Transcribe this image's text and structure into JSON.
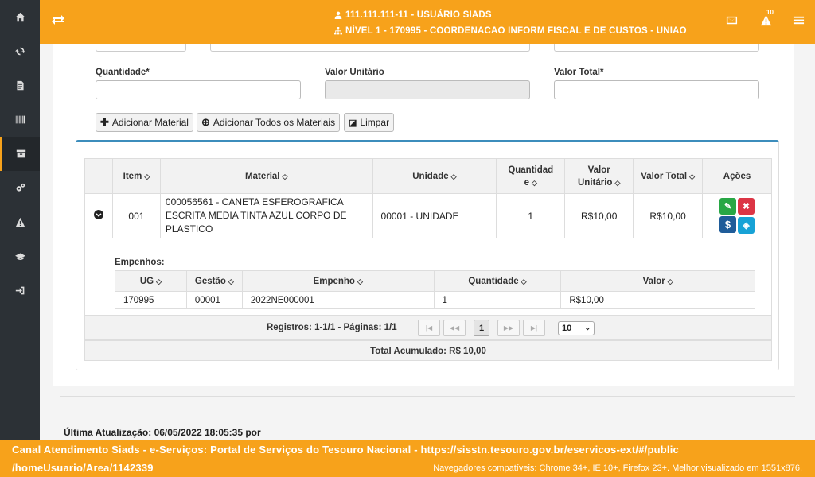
{
  "header": {
    "user": "111.111.111-11 - USUÁRIO SIADS",
    "level": "NÍVEL 1 - 170995 - COORDENACAO INFORM FISCAL E DE CUSTOS - UNIAO",
    "alert_count": "10"
  },
  "sidebar": {
    "items": [
      {
        "icon": "home-icon"
      },
      {
        "icon": "refresh-icon"
      },
      {
        "icon": "document-icon"
      },
      {
        "icon": "barcode-icon"
      },
      {
        "icon": "archive-icon",
        "active": true
      },
      {
        "icon": "gears-icon"
      },
      {
        "icon": "warning-icon"
      },
      {
        "icon": "graduation-cap-icon"
      },
      {
        "icon": "sign-in-icon"
      }
    ]
  },
  "form": {
    "quantidade_label": "Quantidade*",
    "quantidade_value": "",
    "valor_unitario_label": "Valor Unitário",
    "valor_unitario_value": "",
    "valor_total_label": "Valor Total*",
    "valor_total_value": ""
  },
  "buttons": {
    "adicionar": "Adicionar Material",
    "adicionar_todos": "Adicionar Todos os Materiais",
    "limpar": "Limpar"
  },
  "table": {
    "headers": [
      "Item",
      "Material",
      "Unidade",
      "Quantidade",
      "Valor Unitário",
      "Valor Total",
      "Ações"
    ],
    "header_quantidade_l1": "Quantidad",
    "header_quantidade_l2": "e",
    "header_valor_unitario_l1": "Valor",
    "header_valor_unitario_l2": "Unitário",
    "rows": [
      {
        "item": "001",
        "material": "000056561 - CANETA ESFEROGRAFICA ESCRITA MEDIA TINTA AZUL CORPO DE PLASTICO",
        "unidade": "00001 - UNIDADE",
        "quantidade": "1",
        "valor_unitario": "R$10,00",
        "valor_total": "R$10,00"
      }
    ]
  },
  "empenhos": {
    "label": "Empenhos:",
    "headers": [
      "UG",
      "Gestão",
      "Empenho",
      "Quantidade",
      "Valor"
    ],
    "rows": [
      {
        "ug": "170995",
        "gestao": "00001",
        "empenho": "2022NE000001",
        "quantidade": "1",
        "valor": "R$10,00"
      }
    ]
  },
  "pager": {
    "info": "Registros: 1-1/1 - Páginas: 1/1",
    "current_page": "1",
    "page_size": "10"
  },
  "total": "Total Acumulado: R$ 10,00",
  "updated": "Última Atualização: 06/05/2022 18:05:35 por",
  "footer": {
    "line1": "Canal Atendimento Siads - e-Serviços: Portal de Serviços do Tesouro Nacional - https://sisstn.tesouro.gov.br/eservicos-ext/#/public",
    "line2": "/homeUsuario/Area/1142339",
    "browsers": "Navegadores compatíveis: Chrome 34+, IE 10+, Firefox 23+. Melhor visualizado em 1551x876."
  },
  "colors": {
    "accent": "#f7a21b",
    "sidebar": "#2c3136",
    "primary": "#3c8dbc"
  }
}
